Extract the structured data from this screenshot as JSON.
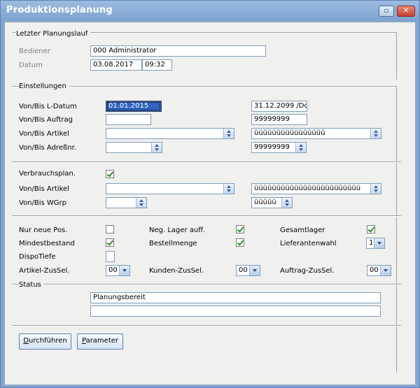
{
  "window": {
    "title": "Produktionsplanung",
    "restore_glyph": "▫",
    "close_glyph": "✕"
  },
  "planungslauf": {
    "heading": "Letzter Planungslauf",
    "bediener_label": "Bediener",
    "bediener_value": "000  Administrator",
    "datum_label": "Datum",
    "datum_value": "03.08.2017",
    "zeit_value": "09:32"
  },
  "einstellungen": {
    "heading": "Einstellungen",
    "ldatum_label": "Von/Bis L-Datum",
    "ldatum_von": "01.01.2015",
    "ldatum_bis": "31.12.2099 /Do",
    "auftrag_label": "Von/Bis Auftrag",
    "auftrag_von": "",
    "auftrag_bis": "99999999",
    "artikel_label": "Von/Bis Artikel",
    "artikel_von": "",
    "artikel_bis": "üüüüüüüüüüüüüüüü",
    "adress_label": "Von/Bis Adreßnr.",
    "adress_von": "",
    "adress_bis": "99999999"
  },
  "verbrauch": {
    "plan_label": "Verbrauchsplan.",
    "plan_checked": true,
    "artikel_label": "Von/Bis Artikel",
    "artikel_von": "",
    "artikel_bis": "üüüüüüüüüüüüüüüüüüüüüüüü",
    "wgrp_label": "Von/Bis WGrp",
    "wgrp_von": "",
    "wgrp_bis": "üüüüü"
  },
  "optionen": {
    "nur_neue_label": "Nur neue Pos.",
    "nur_neue_checked": false,
    "neg_lager_label": "Neg. Lager auff.",
    "neg_lager_checked": true,
    "gesamtlager_label": "Gesamtlager",
    "gesamtlager_checked": true,
    "mindestbestand_label": "Mindestbestand",
    "mindestbestand_checked": true,
    "bestellmenge_label": "Bestellmenge",
    "bestellmenge_checked": true,
    "lieferantenwahl_label": "Lieferantenwahl",
    "lieferantenwahl_value": "1",
    "dispotiefe_label": "DispoTiefe",
    "dispotiefe_value": "",
    "artikel_zussel_label": "Artikel-ZusSel.",
    "artikel_zussel_value": "00",
    "kunden_zussel_label": "Kunden-ZusSel.",
    "kunden_zussel_value": "00",
    "auftrag_zussel_label": "Auftrag-ZusSel.",
    "auftrag_zussel_value": "00"
  },
  "status": {
    "heading": "Status",
    "line1": "Planungsbereit",
    "line2": ""
  },
  "buttons": {
    "durchfuehren_accel": "D",
    "durchfuehren_rest": "urchführen",
    "parameter_accel": "P",
    "parameter_rest": "arameter"
  },
  "colors": {
    "titlebar": "#7ea3d0",
    "focus": "#3162c1",
    "check": "#2f8a2f"
  }
}
